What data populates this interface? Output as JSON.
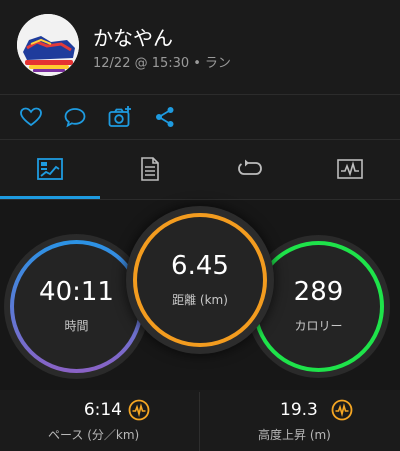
{
  "user": {
    "name": "かなやん",
    "date": "12/22 @ 15:30",
    "separator": "•",
    "activity_type": "ラン"
  },
  "actions": [
    {
      "name": "like",
      "icon": "heart-icon"
    },
    {
      "name": "comment",
      "icon": "comment-icon"
    },
    {
      "name": "add-photo",
      "icon": "camera-plus-icon"
    },
    {
      "name": "share",
      "icon": "share-icon"
    }
  ],
  "tabs": [
    {
      "name": "overview",
      "icon": "overview-icon",
      "selected": true
    },
    {
      "name": "details",
      "icon": "document-icon",
      "selected": false
    },
    {
      "name": "laps",
      "icon": "laps-icon",
      "selected": false
    },
    {
      "name": "charts",
      "icon": "chart-icon",
      "selected": false
    }
  ],
  "stats": {
    "time": {
      "value": "40:11",
      "label": "時間"
    },
    "distance": {
      "value": "6.45",
      "label": "距離 (km)"
    },
    "calories": {
      "value": "289",
      "label": "カロリー"
    }
  },
  "metrics": {
    "pace": {
      "value": "6:14",
      "label": "ペース (分／km)",
      "icon": "activity-chart-icon"
    },
    "elevation": {
      "value": "19.3",
      "label": "高度上昇 (m)",
      "icon": "activity-chart-icon"
    }
  },
  "colors": {
    "accent_blue": "#1e9be0",
    "badge_orange": "#f5a623",
    "distance_ring": "#f39c1f",
    "calories_ring": "#1ee34a",
    "time_ring_top": "#2a93e5",
    "time_ring_bottom": "#8b62c6"
  }
}
